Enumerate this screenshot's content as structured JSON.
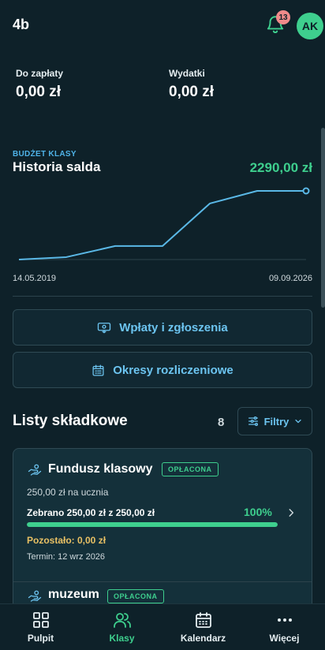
{
  "header": {
    "title": "4b",
    "notification_count": "13",
    "avatar_initials": "AK"
  },
  "stats": [
    {
      "label": "Do zapłaty",
      "value": "0,00 zł"
    },
    {
      "label": "Wydatki",
      "value": "0,00 zł"
    }
  ],
  "budget": {
    "kicker": "BUDŻET KLASY",
    "title": "Historia salda",
    "amount": "2290,00 zł",
    "start_date": "14.05.2019",
    "end_date": "09.09.2026"
  },
  "chart_data": {
    "type": "line",
    "x": [
      "14.05.2019",
      "09.09.2026"
    ],
    "values": [
      0,
      80,
      450,
      450,
      1870,
      2290,
      2290
    ],
    "ylim": [
      0,
      2290
    ],
    "grid": false,
    "color": "#5ab8e6"
  },
  "actions": {
    "payments_label": "Wpłaty i zgłoszenia",
    "periods_label": "Okresy rozliczeniowe"
  },
  "lists": {
    "title": "Listy składkowe",
    "count": "8",
    "filter_label": "Filtry",
    "items": [
      {
        "name": "Fundusz klasowy",
        "status": "OPŁACONA",
        "per_person": "250,00 zł na ucznia",
        "collected": "Zebrano 250,00 zł z 250,00 zł",
        "percent": "100%",
        "progress": 1.0,
        "remaining": "Pozostało: 0,00 zł",
        "deadline": "Termin: 12 wrz 2026"
      },
      {
        "name": "muzeum",
        "status": "OPŁACONA"
      }
    ]
  },
  "nav": {
    "items": [
      {
        "label": "Pulpit",
        "icon": "grid-icon"
      },
      {
        "label": "Klasy",
        "icon": "users-icon"
      },
      {
        "label": "Kalendarz",
        "icon": "calendar-icon"
      },
      {
        "label": "Więcej",
        "icon": "more-icon"
      }
    ]
  },
  "colors": {
    "accent_green": "#3ecf8e",
    "accent_blue": "#6cc4f0",
    "warning": "#e8c064",
    "background": "#0e2129"
  }
}
